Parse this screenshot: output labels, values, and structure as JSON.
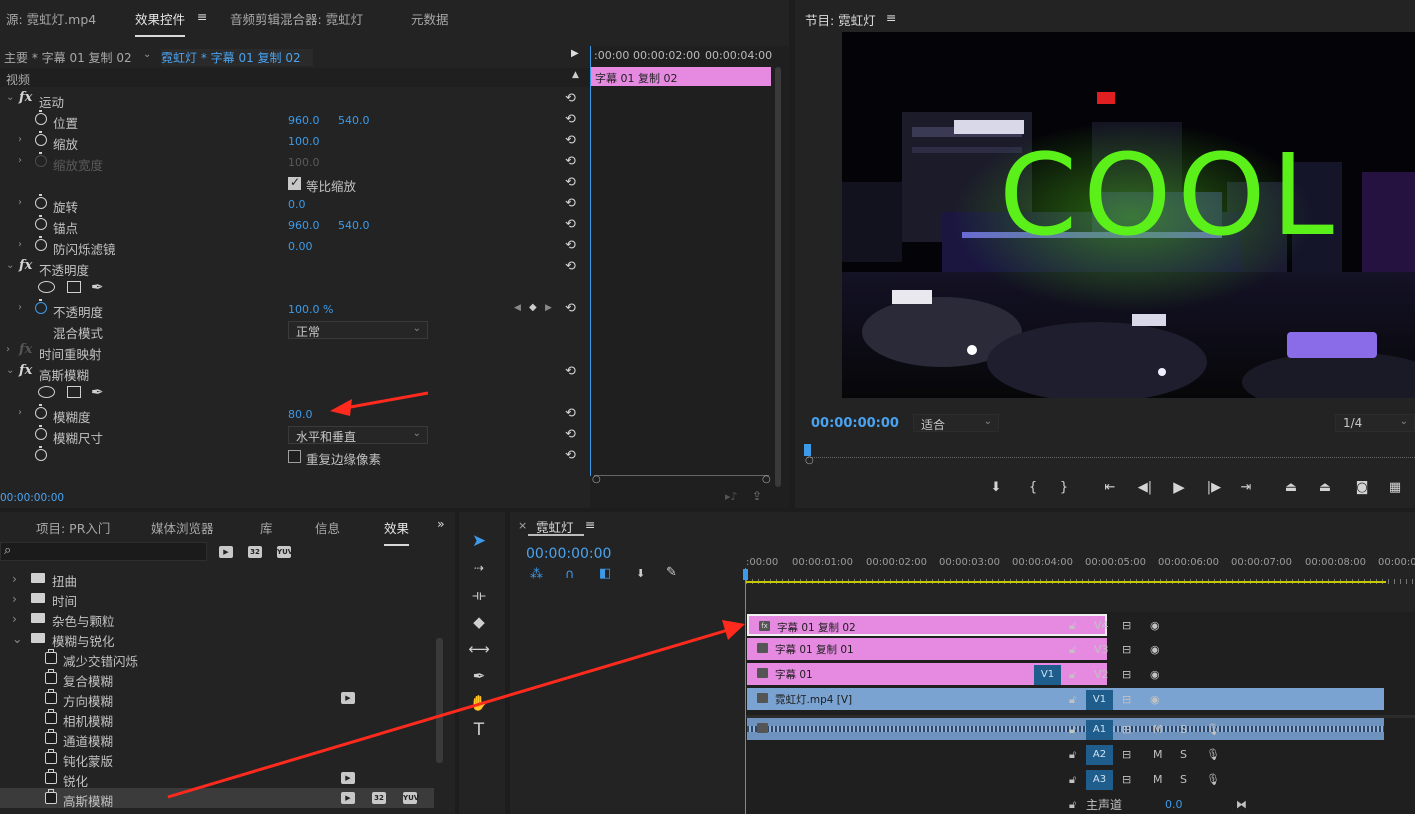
{
  "source_panel": {
    "tabs": [
      "源: 霓虹灯.mp4",
      "效果控件",
      "音频剪辑混合器: 霓虹灯",
      "元数据"
    ],
    "active_tab_menu": "≡",
    "clip_path_main": "主要 * 字幕 01 复制 02",
    "clip_path_seq": "霓虹灯 * 字幕 01 复制 02",
    "mini_ruler": [
      ":00:00",
      "00:00:02:00",
      "00:00:04:00"
    ],
    "mini_clip_label": "字幕 01 复制 02",
    "section_video": "视频",
    "timecode": "00:00:00:00",
    "effects": {
      "motion": {
        "name": "运动",
        "position_label": "位置",
        "position_x": "960.0",
        "position_y": "540.0",
        "scale_label": "缩放",
        "scale_value": "100.0",
        "scale_width_label": "缩放宽度",
        "scale_width_value": "100.0",
        "uniform_scale_label": "等比缩放",
        "rotation_label": "旋转",
        "rotation_value": "0.0",
        "anchor_label": "锚点",
        "anchor_x": "960.0",
        "anchor_y": "540.0",
        "antiflicker_label": "防闪烁滤镜",
        "antiflicker_value": "0.00"
      },
      "opacity": {
        "name": "不透明度",
        "opacity_label": "不透明度",
        "opacity_value": "100.0 %",
        "blend_label": "混合模式",
        "blend_value": "正常"
      },
      "time_remap": {
        "name": "时间重映射"
      },
      "gaussian_blur": {
        "name": "高斯模糊",
        "blurriness_label": "模糊度",
        "blurriness_value": "80.0",
        "dimension_label": "模糊尺寸",
        "dimension_value": "水平和垂直",
        "repeat_edge_label": "重复边缘像素"
      }
    }
  },
  "program_panel": {
    "title": "节目: 霓虹灯",
    "menu": "≡",
    "timecode": "00:00:00:00",
    "fit_label": "适合",
    "resolution": "1/4",
    "video_text": "COOL"
  },
  "project_panel": {
    "tabs": [
      "项目: PR入门",
      "媒体浏览器",
      "库",
      "信息",
      "效果"
    ],
    "overflow": "»",
    "tree": [
      {
        "label": "扭曲",
        "type": "folder",
        "open": false
      },
      {
        "label": "时间",
        "type": "folder",
        "open": false
      },
      {
        "label": "杂色与颗粒",
        "type": "folder",
        "open": false
      },
      {
        "label": "模糊与锐化",
        "type": "folder",
        "open": true
      },
      {
        "label": "减少交错闪烁",
        "type": "effect"
      },
      {
        "label": "复合模糊",
        "type": "effect"
      },
      {
        "label": "方向模糊",
        "type": "effect"
      },
      {
        "label": "相机模糊",
        "type": "effect"
      },
      {
        "label": "通道模糊",
        "type": "effect"
      },
      {
        "label": "钝化蒙版",
        "type": "effect"
      },
      {
        "label": "锐化",
        "type": "effect"
      },
      {
        "label": "高斯模糊",
        "type": "effect"
      }
    ],
    "badges": [
      "32",
      "YUV"
    ]
  },
  "timeline": {
    "title": "霓虹灯",
    "menu": "≡",
    "close": "×",
    "timecode": "00:00:00:00",
    "ruler": [
      ":00:00",
      "00:00:01:00",
      "00:00:02:00",
      "00:00:03:00",
      "00:00:04:00",
      "00:00:05:00",
      "00:00:06:00",
      "00:00:07:00",
      "00:00:08:00",
      "00:00:0"
    ],
    "tracks": {
      "v4": "V4",
      "v3": "V3",
      "v2": "V2",
      "v1": "V1",
      "v1_src": "V1",
      "a1": "A1",
      "a2": "A2",
      "a3": "A3",
      "m": "M",
      "s": "S",
      "master_label": "主声道",
      "master_value": "0.0"
    },
    "clips": {
      "v4": "字幕 01 复制 02",
      "v3": "字幕 01 复制 01",
      "v2": "字幕 01",
      "v1": "霓虹灯.mp4 [V]"
    }
  },
  "colors": {
    "accent_blue": "#3d9ae8",
    "clip_pink": "#e58ae0",
    "clip_video": "#7aa3d2",
    "neon_green": "#5cf01a",
    "arrow_red": "#ff2a1e"
  }
}
